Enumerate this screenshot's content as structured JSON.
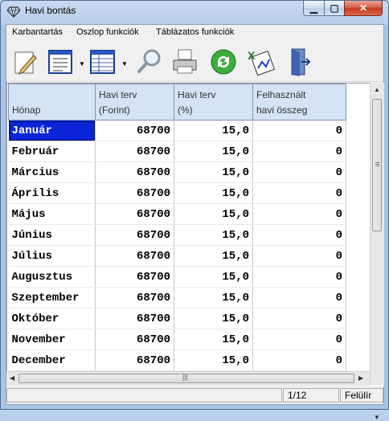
{
  "window": {
    "title": "Havi bontás"
  },
  "menu": [
    "Karbantartás",
    "Oszlop funkciók",
    "Táblázatos funkciók"
  ],
  "toolbar": [
    "edit-icon",
    "form-view-icon",
    "table-view-icon",
    "search-icon",
    "print-icon",
    "refresh-icon",
    "excel-export-icon",
    "exit-door-icon"
  ],
  "table": {
    "headers": [
      {
        "l1": "",
        "l2": "Hónap"
      },
      {
        "l1": "Havi terv",
        "l2": "(Forint)"
      },
      {
        "l1": "Havi terv",
        "l2": "(%)"
      },
      {
        "l1": "Felhasznált",
        "l2": "havi összeg"
      }
    ],
    "rows": [
      [
        "Január",
        "68700",
        "15,0",
        "0"
      ],
      [
        "Február",
        "68700",
        "15,0",
        "0"
      ],
      [
        "Március",
        "68700",
        "15,0",
        "0"
      ],
      [
        "Április",
        "68700",
        "15,0",
        "0"
      ],
      [
        "Május",
        "68700",
        "15,0",
        "0"
      ],
      [
        "Június",
        "68700",
        "15,0",
        "0"
      ],
      [
        "Július",
        "68700",
        "15,0",
        "0"
      ],
      [
        "Augusztus",
        "68700",
        "15,0",
        "0"
      ],
      [
        "Szeptember",
        "68700",
        "15,0",
        "0"
      ],
      [
        "Október",
        "68700",
        "15,0",
        "0"
      ],
      [
        "November",
        "68700",
        "15,0",
        "0"
      ],
      [
        "December",
        "68700",
        "15,0",
        "0"
      ]
    ],
    "selected_row": 0
  },
  "status": {
    "position": "1/12",
    "mode": "Felülír"
  },
  "colors": {
    "selection": "#0a24d8",
    "header": "#d5e3f5"
  }
}
